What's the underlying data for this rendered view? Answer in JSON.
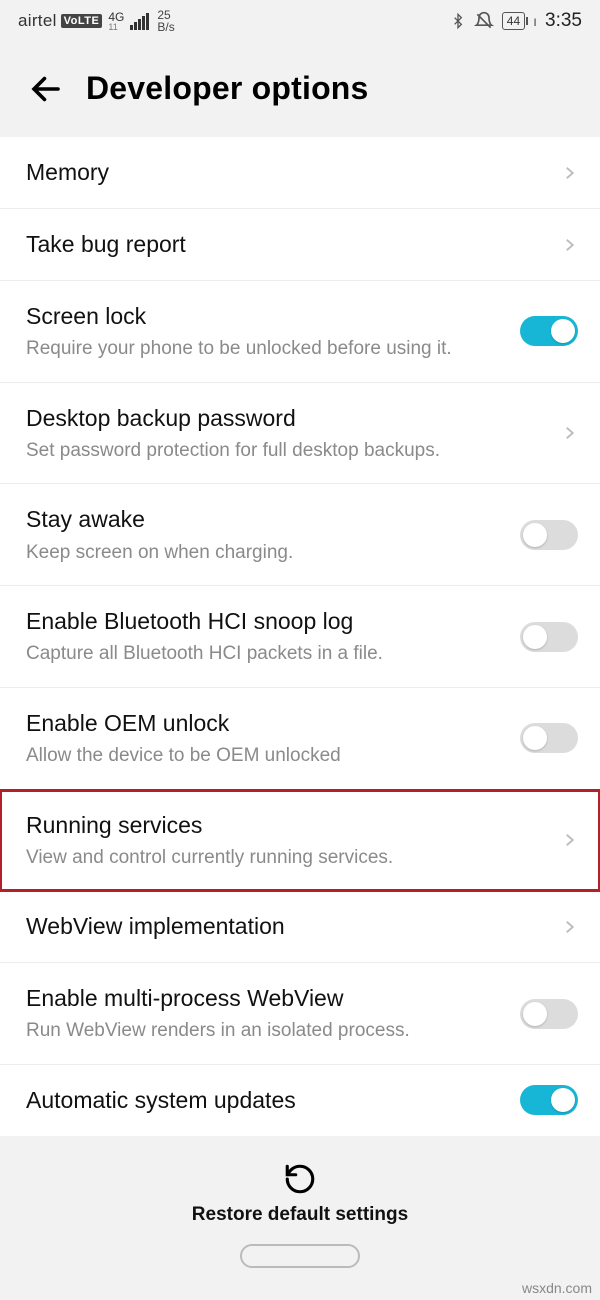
{
  "status": {
    "carrier": "airtel",
    "volte": "VoLTE",
    "net_top": "4G",
    "net_bot": "11",
    "speed_top": "25",
    "speed_bot": "B/s",
    "battery": "44",
    "time": "3:35"
  },
  "header": {
    "title": "Developer options"
  },
  "items": {
    "memory": {
      "title": "Memory"
    },
    "bugreport": {
      "title": "Take bug report"
    },
    "screenlock": {
      "title": "Screen lock",
      "desc": "Require your phone to be unlocked before using it."
    },
    "desktop": {
      "title": "Desktop backup password",
      "desc": "Set password protection for full desktop backups."
    },
    "stayawake": {
      "title": "Stay awake",
      "desc": "Keep screen on when charging."
    },
    "bthci": {
      "title": "Enable Bluetooth HCI snoop log",
      "desc": "Capture all Bluetooth HCI packets in a file."
    },
    "oem": {
      "title": "Enable OEM unlock",
      "desc": "Allow the device to be OEM unlocked"
    },
    "running": {
      "title": "Running services",
      "desc": "View and control currently running services."
    },
    "webview": {
      "title": "WebView implementation"
    },
    "mpwv": {
      "title": "Enable multi-process WebView",
      "desc": "Run WebView renders in an isolated process."
    },
    "autosys": {
      "title": "Automatic system updates"
    }
  },
  "footer": {
    "restore": "Restore default settings"
  },
  "watermark": "wsxdn.com"
}
